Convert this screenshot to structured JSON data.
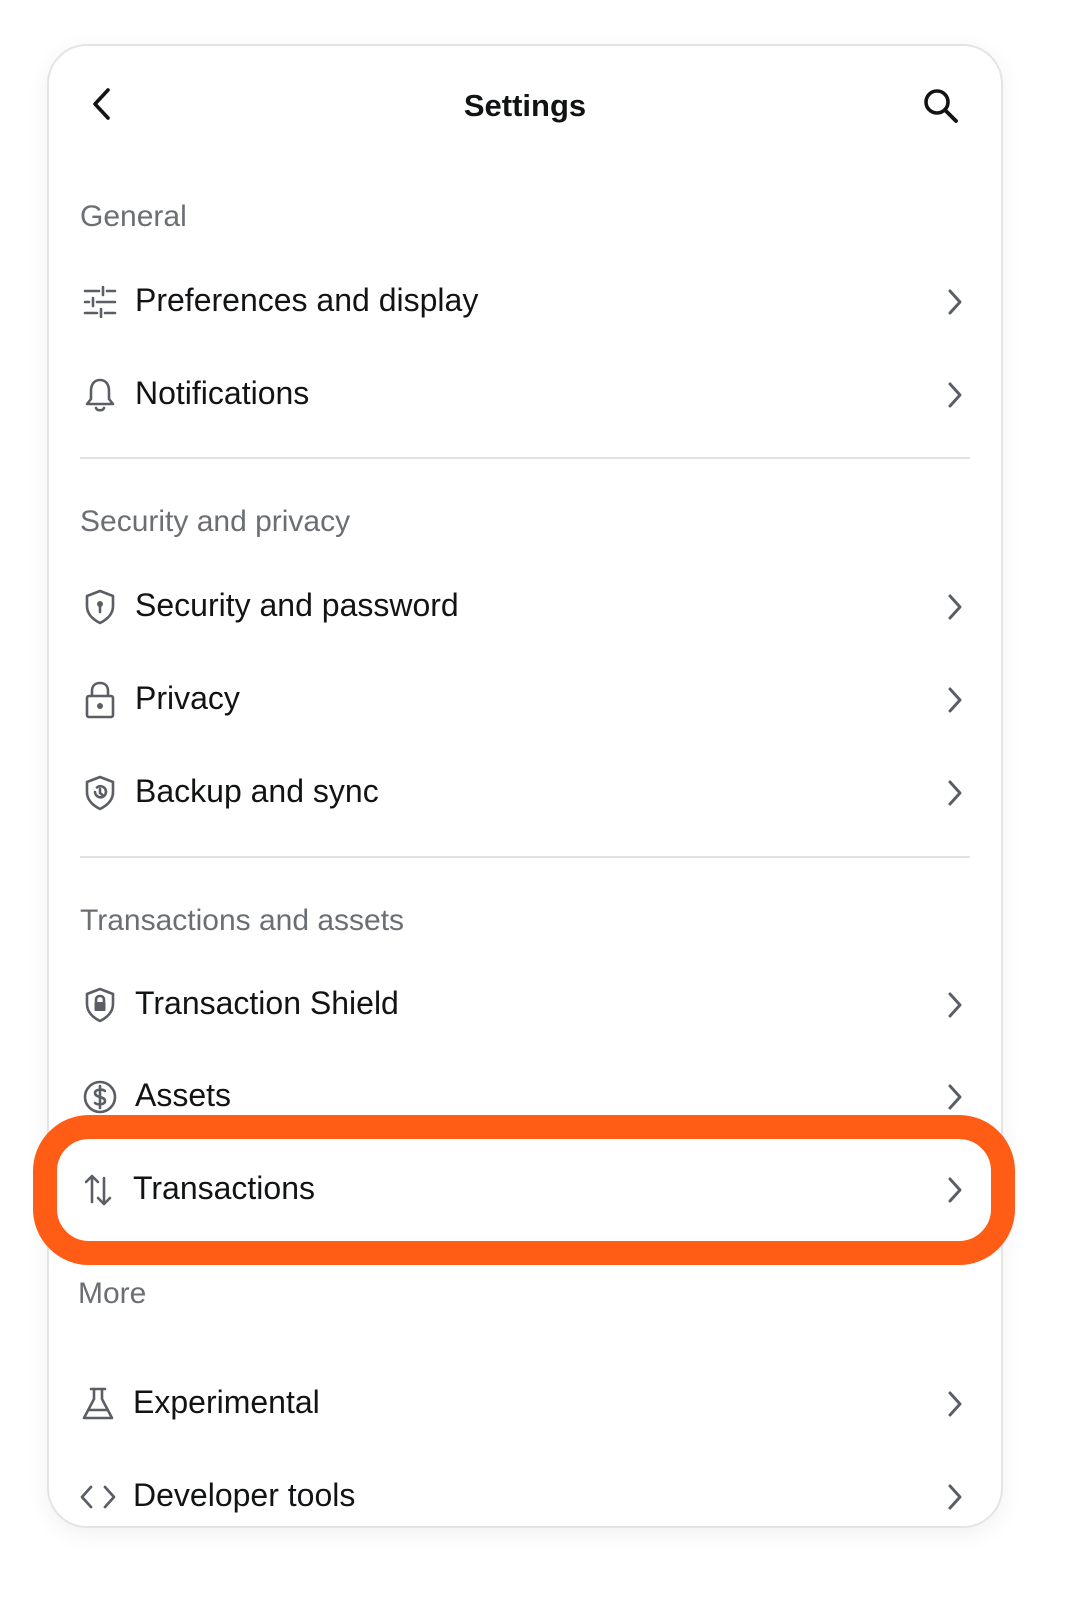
{
  "header": {
    "title": "Settings",
    "back_icon": "chevron-left-icon",
    "search_icon": "search-icon"
  },
  "sections": {
    "general": {
      "label": "General",
      "items": [
        {
          "label": "Preferences and display",
          "icon": "sliders-icon"
        },
        {
          "label": "Notifications",
          "icon": "bell-icon"
        }
      ]
    },
    "security": {
      "label": "Security and privacy",
      "items": [
        {
          "label": "Security and password",
          "icon": "shield-icon"
        },
        {
          "label": "Privacy",
          "icon": "lock-icon"
        },
        {
          "label": "Backup and sync",
          "icon": "shield-sync-icon"
        }
      ]
    },
    "transactions": {
      "label": "Transactions and assets",
      "items": [
        {
          "label": "Transaction Shield",
          "icon": "shield-lock-icon"
        },
        {
          "label": "Assets",
          "icon": "dollar-circle-icon"
        },
        {
          "label": "Transactions",
          "icon": "arrows-swap-icon"
        }
      ]
    },
    "more": {
      "label": "More",
      "items": [
        {
          "label": "Experimental",
          "icon": "flask-icon"
        },
        {
          "label": "Developer tools",
          "icon": "code-icon"
        }
      ]
    }
  },
  "highlight_color": "#ff5c16"
}
